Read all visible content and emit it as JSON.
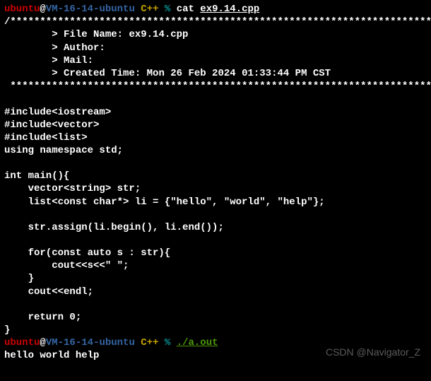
{
  "prompt1": {
    "user": "ubuntu",
    "at": "@",
    "host": "VM-16-14-ubuntu",
    "path": " C++ ",
    "pct": "% ",
    "cmd": "cat ",
    "arg": "ex9.14.cpp"
  },
  "file_header": {
    "border_top": "/*****************************************************************************",
    "file_name_label": "        > File Name: ",
    "file_name_value": "ex9.14.cpp",
    "author_label": "        > Author: ",
    "author_value": "",
    "mail_label": "        > Mail: ",
    "mail_value": "",
    "created_label": "        > Created Time: ",
    "created_value": "Mon 26 Feb 2024 01:33:44 PM CST",
    "border_bottom": " ****************************************************************************/"
  },
  "code": {
    "l1": "#include<iostream>",
    "l2": "#include<vector>",
    "l3": "#include<list>",
    "l4": "using namespace std;",
    "l5": "",
    "l6": "int main(){",
    "l7": "    vector<string> str;",
    "l8": "    list<const char*> li = {\"hello\", \"world\", \"help\"};",
    "l9": "",
    "l10": "    str.assign(li.begin(), li.end());",
    "l11": "",
    "l12": "    for(const auto s : str){",
    "l13": "        cout<<s<<\" \";",
    "l14": "    }",
    "l15": "    cout<<endl;",
    "l16": "",
    "l17": "    return 0;",
    "l18": "}"
  },
  "prompt2": {
    "user": "ubuntu",
    "at": "@",
    "host": "VM-16-14-ubuntu",
    "path": " C++ ",
    "pct": "% ",
    "exec": "./a.out"
  },
  "output": "hello world help ",
  "watermark": "CSDN @Navigator_Z"
}
